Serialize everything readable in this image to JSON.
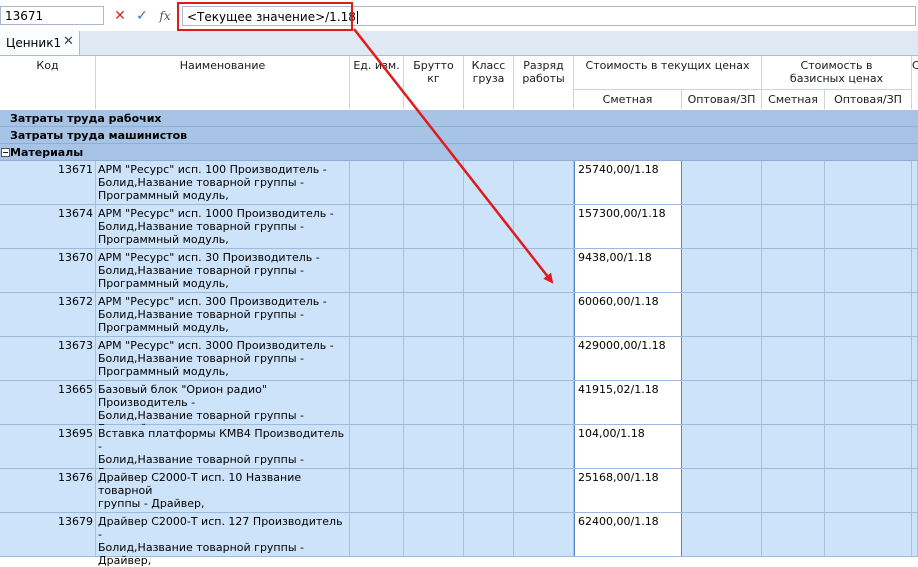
{
  "formula_bar": {
    "cell_ref": "13671",
    "formula": "<Текущее значение>/1.18",
    "fx_label": "fx"
  },
  "tab": {
    "label": "Ценник1",
    "close_glyph": "✕"
  },
  "columns": {
    "code": "Код",
    "name": "Наименование",
    "unit": "Ед. изм.",
    "gross": "Брутто кг",
    "cargo_class": "Класс груза",
    "work_rank": "Разряд работы",
    "current_cost": "Стоимость в текущих ценах",
    "base_cost": "Стоимость в базисных ценах",
    "estimate": "Сметная",
    "wholesale": "Оптовая/ЗП",
    "base_estimate": "Сметная",
    "base_wholesale": "Оптовая/ЗП",
    "extra": "С"
  },
  "groups": {
    "labor_workers": "Затраты труда рабочих",
    "labor_operators": "Затраты труда машинистов",
    "materials": "Материалы"
  },
  "rows": [
    {
      "code": "13671",
      "name": "АРМ \"Ресурс\" исп. 100 Производитель -\nБолид,Название товарной группы -\nПрограммный модуль,",
      "estimate": "25740,00/1.18"
    },
    {
      "code": "13674",
      "name": "АРМ \"Ресурс\" исп. 1000 Производитель -\nБолид,Название товарной группы -\nПрограммный модуль,",
      "estimate": "157300,00/1.18"
    },
    {
      "code": "13670",
      "name": "АРМ \"Ресурс\" исп. 30 Производитель -\nБолид,Название товарной группы -\nПрограммный модуль,",
      "estimate": "9438,00/1.18"
    },
    {
      "code": "13672",
      "name": "АРМ \"Ресурс\" исп. 300 Производитель -\nБолид,Название товарной группы -\nПрограммный модуль,",
      "estimate": "60060,00/1.18"
    },
    {
      "code": "13673",
      "name": "АРМ \"Ресурс\" исп. 3000 Производитель -\nБолид,Название товарной группы -\nПрограммный модуль,",
      "estimate": "429000,00/1.18"
    },
    {
      "code": "13665",
      "name": "Базовый блок \"Орион радио\" Производитель -\nБолид,Название товарной группы - Базовый\nблок ,",
      "estimate": "41915,02/1.18"
    },
    {
      "code": "13695",
      "name": "Вставка платформы КМВ4 Производитель -\nБолид,Название товарной группы - Вставка\nплатформы,",
      "estimate": "104,00/1.18"
    },
    {
      "code": "13676",
      "name": "Драйвер С2000-Т исп. 10 Название товарной\nгруппы - Драйвер,",
      "estimate": "25168,00/1.18"
    },
    {
      "code": "13679",
      "name": "Драйвер С2000-Т исп. 127 Производитель -\nБолид,Название товарной группы - Драйвер,",
      "estimate": "62400,00/1.18"
    }
  ],
  "colors": {
    "annotation": "#e01b1b",
    "group_bg": "#a7c4e6",
    "row_bg": "#cde3fa",
    "edit_cell_bg": "#ffffff"
  }
}
